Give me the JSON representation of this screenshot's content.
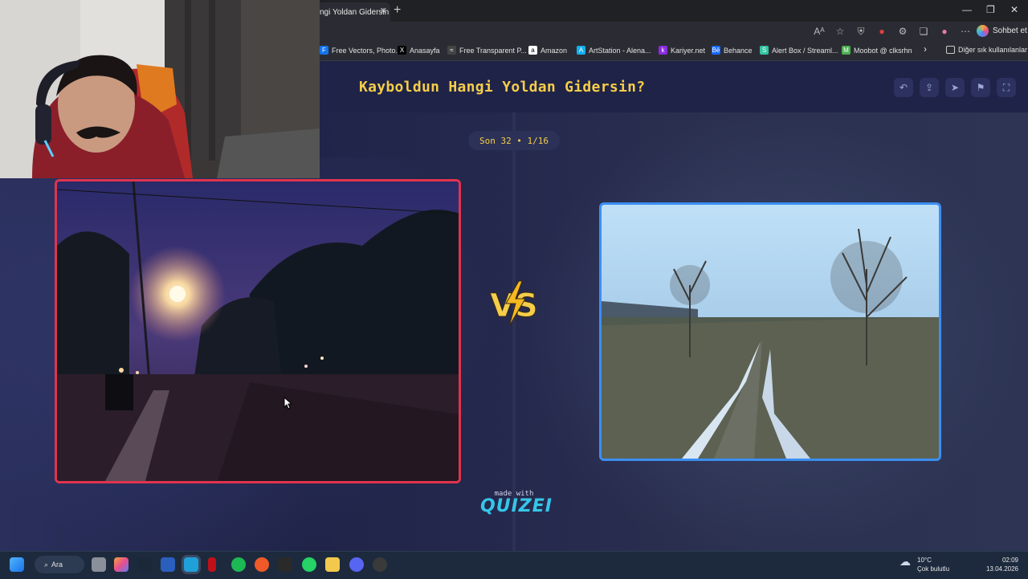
{
  "browser": {
    "tab_title": "ngi Yoldan Gidersin ?",
    "new_tab": "+",
    "window_controls": {
      "minimize": "—",
      "maximize": "❐",
      "close": "✕"
    },
    "copilot_label": "Sohbet et",
    "bookmarks": [
      {
        "label": "Free Vectors, Photo...",
        "icon": "F",
        "color": "#1273eb"
      },
      {
        "label": "Anasayfa",
        "icon": "X",
        "color": "#000000"
      },
      {
        "label": "Free Transparent P...",
        "icon": "≈",
        "color": "#444444"
      },
      {
        "label": "Amazon",
        "icon": "a",
        "color": "#ffffff"
      },
      {
        "label": "ArtStation - Alena...",
        "icon": "A",
        "color": "#13aff0"
      },
      {
        "label": "Kariyer.net",
        "icon": "k",
        "color": "#8a2be2"
      },
      {
        "label": "Behance",
        "icon": "Bē",
        "color": "#1769ff"
      },
      {
        "label": "Alert Box / Streaml...",
        "icon": "S",
        "color": "#31c3a2"
      },
      {
        "label": "Moobot @ clksrhn",
        "icon": "M",
        "color": "#4caf50"
      }
    ],
    "bookmarks_more": "›",
    "other_favorites": "Diğer sık kullanılanlar"
  },
  "quiz": {
    "title": "Kayboldun Hangi Yoldan Gidersin?",
    "round": "Son 32 • 1/16",
    "vs_label": "VS",
    "made_with": "made with",
    "brand": "QUIZEI",
    "toolbar": [
      {
        "name": "undo-icon",
        "glyph": "↶"
      },
      {
        "name": "share-icon",
        "glyph": "⇪"
      },
      {
        "name": "send-icon",
        "glyph": "➤"
      },
      {
        "name": "flag-icon",
        "glyph": "⚑"
      },
      {
        "name": "fullscreen-icon",
        "glyph": "⛶"
      }
    ]
  },
  "taskbar": {
    "search_label": "Ara",
    "weather_temp": "10°C",
    "weather_desc": "Çok bulutlu",
    "time": "02:09",
    "date": "13.04.2026"
  },
  "colors": {
    "accent_yellow": "#f5cd4a",
    "left_border": "#e0344d",
    "right_border": "#3b8ff2",
    "brand_cyan": "#35c6e8"
  }
}
